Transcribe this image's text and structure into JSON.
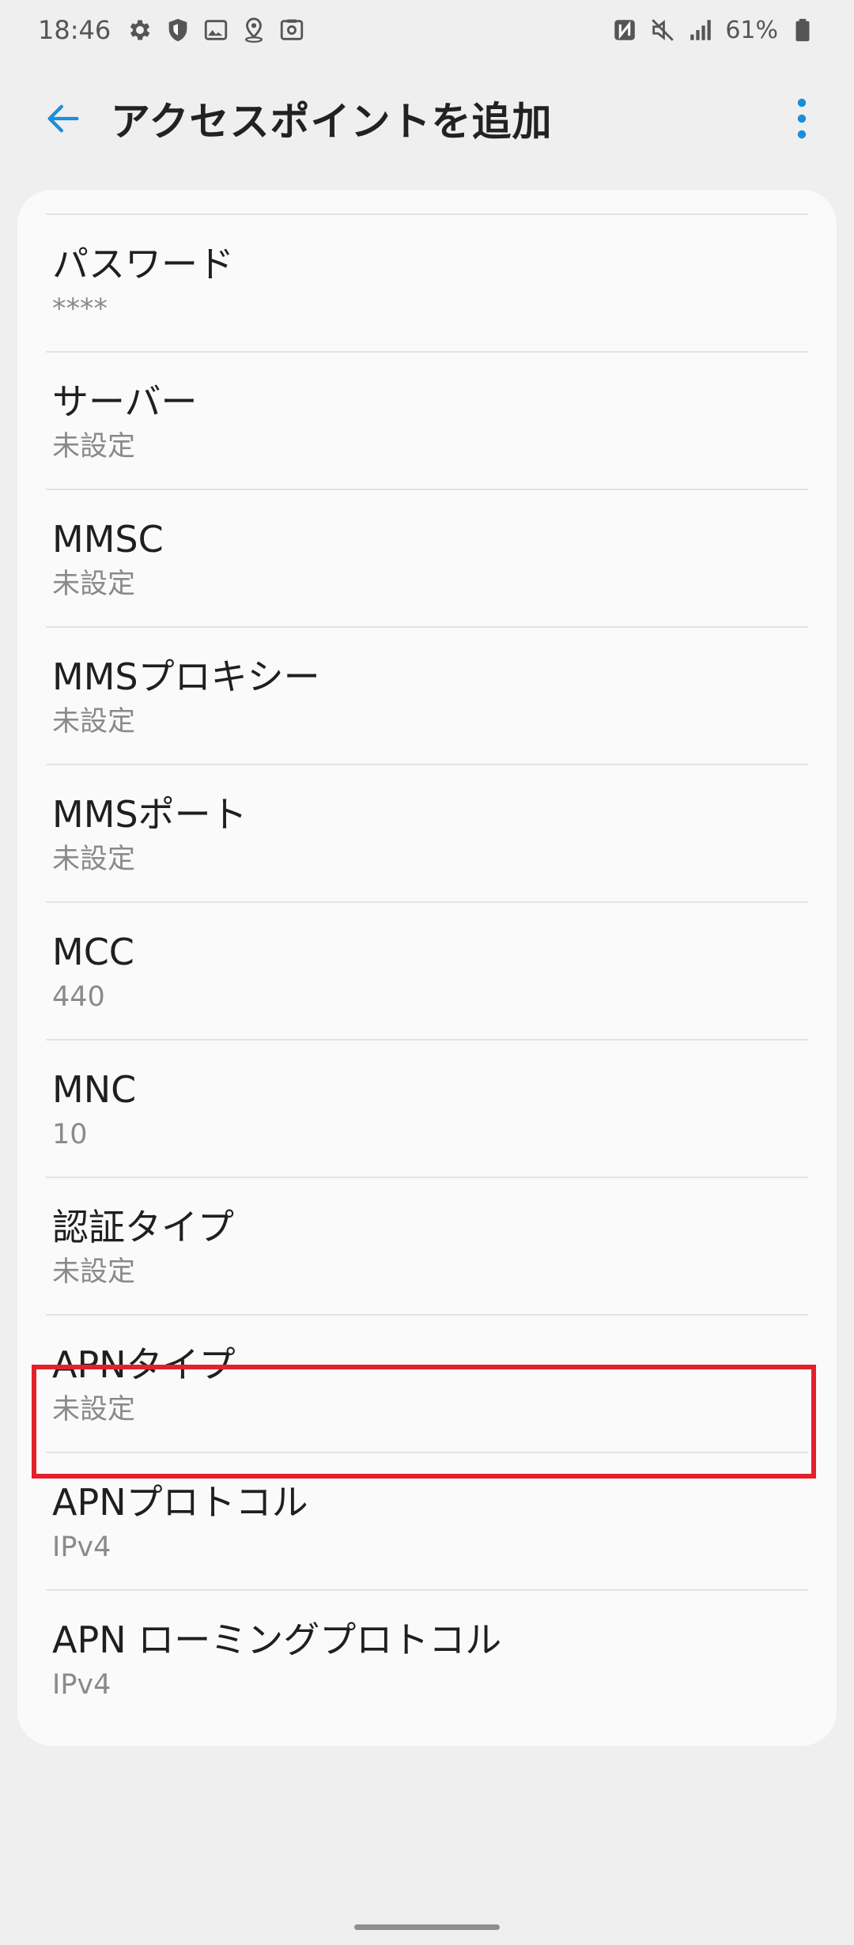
{
  "status_bar": {
    "time": "18:46",
    "battery_percent": "61%",
    "left_icons": [
      "gear-icon",
      "shield-icon",
      "image-icon",
      "location-pin-icon",
      "screenshot-icon"
    ],
    "right_icons": [
      "nfc-icon",
      "mute-icon",
      "signal-icon",
      "battery-icon"
    ]
  },
  "app_bar": {
    "title": "アクセスポイントを追加"
  },
  "colors": {
    "accent": "#1a8fd9",
    "highlight": "#e3212b",
    "background": "#efefef",
    "card": "#fafafa"
  },
  "settings": {
    "items": [
      {
        "label": "パスワード",
        "value": "****"
      },
      {
        "label": "サーバー",
        "value": "未設定"
      },
      {
        "label": "MMSC",
        "value": "未設定"
      },
      {
        "label": "MMSプロキシー",
        "value": "未設定"
      },
      {
        "label": "MMSポート",
        "value": "未設定"
      },
      {
        "label": "MCC",
        "value": "440"
      },
      {
        "label": "MNC",
        "value": "10"
      },
      {
        "label": "認証タイプ",
        "value": "未設定"
      },
      {
        "label": "APNタイプ",
        "value": "未設定"
      },
      {
        "label": "APNプロトコル",
        "value": "IPv4"
      },
      {
        "label": "APN ローミングプロトコル",
        "value": "IPv4"
      }
    ]
  }
}
